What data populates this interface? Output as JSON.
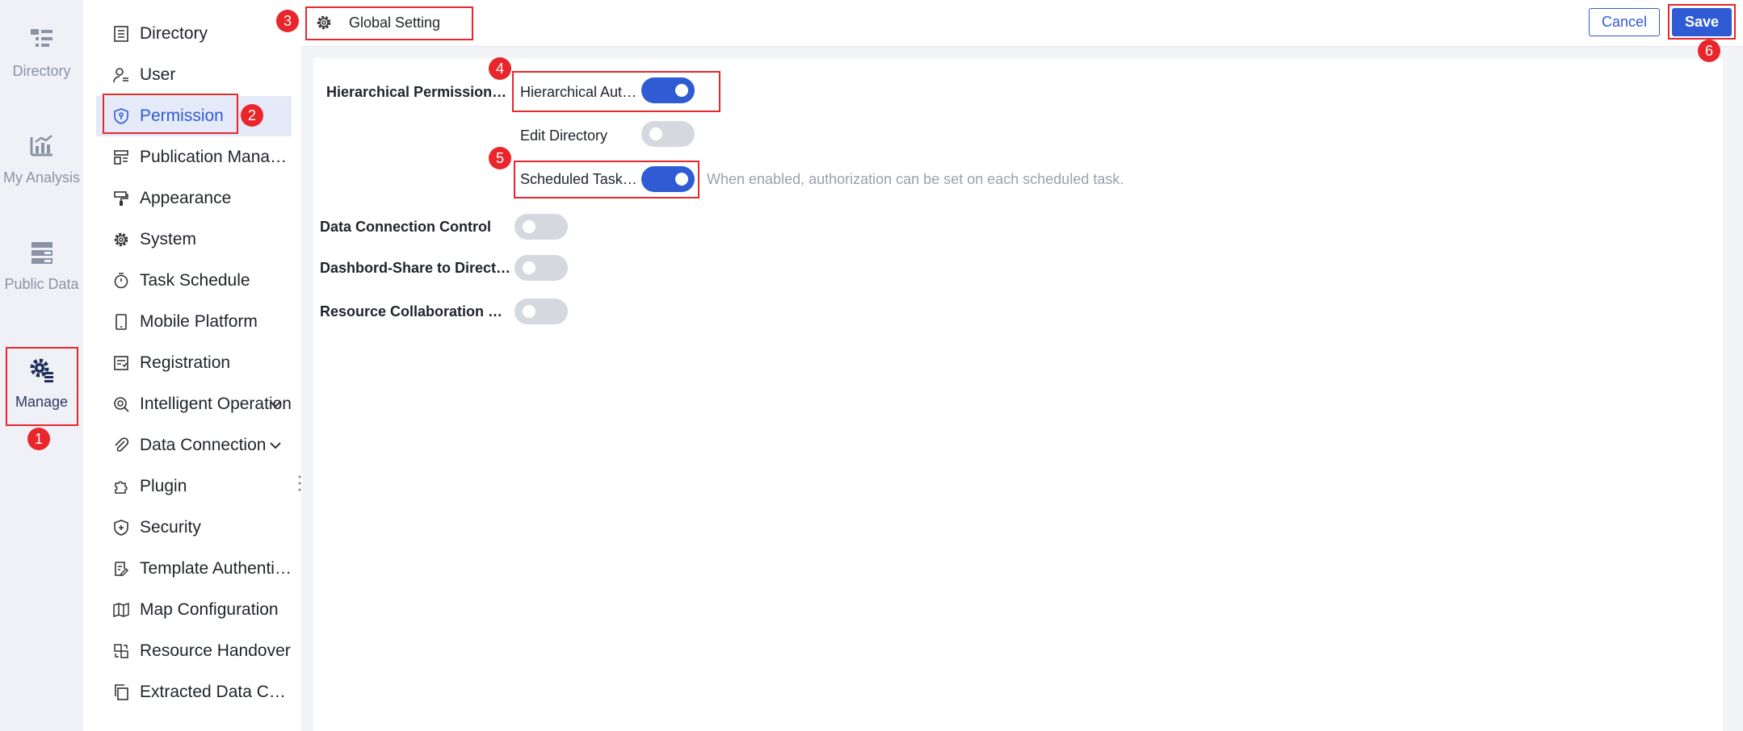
{
  "rail": {
    "items": [
      {
        "label": "Directory",
        "icon": "directory-list-icon"
      },
      {
        "label": "My Analysis",
        "icon": "analysis-chart-icon"
      },
      {
        "label": "Public Data",
        "icon": "public-data-icon"
      },
      {
        "label": "Manage",
        "icon": "manage-gear-icon"
      }
    ]
  },
  "nav": {
    "items": [
      {
        "label": "Directory",
        "icon": "list-icon"
      },
      {
        "label": "User",
        "icon": "user-icon"
      },
      {
        "label": "Permission",
        "icon": "shield-icon"
      },
      {
        "label": "Publication Management",
        "icon": "publication-icon"
      },
      {
        "label": "Appearance",
        "icon": "paint-roller-icon"
      },
      {
        "label": "System",
        "icon": "gear-icon"
      },
      {
        "label": "Task Schedule",
        "icon": "timer-icon"
      },
      {
        "label": "Mobile Platform",
        "icon": "mobile-icon"
      },
      {
        "label": "Registration",
        "icon": "registration-icon"
      },
      {
        "label": "Intelligent Operation",
        "icon": "ops-icon"
      },
      {
        "label": "Data Connection",
        "icon": "paperclip-icon"
      },
      {
        "label": "Plugin",
        "icon": "puzzle-icon"
      },
      {
        "label": "Security",
        "icon": "shield-plus-icon"
      },
      {
        "label": "Template Authentication",
        "icon": "template-icon"
      },
      {
        "label": "Map Configuration",
        "icon": "map-icon"
      },
      {
        "label": "Resource Handover",
        "icon": "handover-icon"
      },
      {
        "label": "Extracted Data Cache",
        "icon": "copy-icon"
      }
    ]
  },
  "header": {
    "crumb": "Global Setting",
    "cancel": "Cancel",
    "save": "Save"
  },
  "settings": {
    "hierarchical_permission": "Hierarchical Permission Management",
    "hierarchical_auth": "Hierarchical Authorization",
    "edit_directory": "Edit Directory",
    "scheduled_task": "Scheduled Task Authorization",
    "scheduled_task_hint": "When enabled, authorization can be set on each scheduled task.",
    "data_connection_control": "Data Connection Control",
    "dashboard_share": "Dashbord-Share to Directory",
    "resource_collab": "Resource Collaboration Control",
    "toggles": {
      "hierarchical_auth": true,
      "edit_directory": false,
      "scheduled_task": true,
      "data_connection_control": false,
      "dashboard_share": false,
      "resource_collab": false
    }
  },
  "annotations": [
    "1",
    "2",
    "3",
    "4",
    "5",
    "6"
  ],
  "colors": {
    "accent": "#2f5bd4",
    "annotation": "#e8262b",
    "rail_bg": "#eff1f6",
    "active_nav_bg": "#e5eaf8"
  }
}
